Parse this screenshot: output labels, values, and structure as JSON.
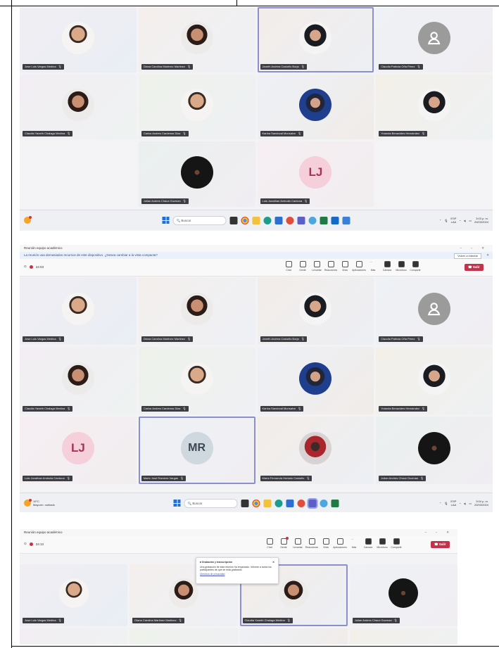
{
  "shot1": {
    "tiles": [
      {
        "name": "Jose Luis Vargas Medina",
        "avatar": "photo"
      },
      {
        "name": "Diana Carolina Martinez Martinez",
        "avatar": "photo"
      },
      {
        "name": "Janeth Andrea Castaño Borja",
        "avatar": "photo"
      },
      {
        "name": "Claudia Patricia Oña Pérez",
        "avatar": "placeholder"
      },
      {
        "name": "Claudia Yaneth Chalaga Medina",
        "avatar": "photo"
      },
      {
        "name": "Carlos Andres Cardenas Diaz",
        "avatar": "photo"
      },
      {
        "name": "Karina Sandoval Monsalve",
        "avatar": "photo"
      },
      {
        "name": "Yolanda Benavides Hernández",
        "avatar": "photo"
      },
      {
        "name": "",
        "avatar": "none"
      },
      {
        "name": "Julian Andres Chaux Guzman",
        "avatar": "photo"
      },
      {
        "name": "Luis Jonathan Ambuila Cardona",
        "avatar": "initials",
        "initials": "LJ"
      }
    ],
    "taskbar": {
      "search": "Buscar",
      "lang": "ESP",
      "region": "LAA",
      "time": "3:03 p. m.",
      "date": "20/03/2024"
    }
  },
  "shot2": {
    "title": "Reunión equipo académico",
    "infobar": "La reunión usa demasiados recursos de este dispositivo. ¿Desea cambiar a la vista compacta?",
    "infobar_button": "Volver a intentar",
    "timer": "24:03",
    "tools": [
      "Chat",
      "Gente",
      "Levantar",
      "Reacciones",
      "Vista",
      "Aplicaciones",
      "Más",
      "Cámara",
      "Micrófono",
      "Compartir"
    ],
    "leave": "Salir",
    "tiles": [
      {
        "name": "Jose Luis Vargas Medina"
      },
      {
        "name": "Diana Carolina Martinez Martinez"
      },
      {
        "name": "Janeth Andrea Castaño Borja"
      },
      {
        "name": "Claudia Patricia Oña Pérez"
      },
      {
        "name": "Claudia Yaneth Chalaga Medina"
      },
      {
        "name": "Carlos Andres Cardenas Diaz"
      },
      {
        "name": "Karina Sandoval Monsalve"
      },
      {
        "name": "Yolanda Benavides Hernández"
      },
      {
        "name": "Luis Jonathan Ambuila Cardona",
        "initials": "LJ"
      },
      {
        "name": "Mario José Ramírez Vargas",
        "initials": "MR"
      },
      {
        "name": "María Fernanda Hurtado Castaño"
      },
      {
        "name": "Julian Andres Chaux Guzman"
      }
    ],
    "taskbar": {
      "weather": "19°C",
      "weather_desc": "Mayorm. nublado",
      "search": "Buscar",
      "lang": "ESP",
      "region": "LAA",
      "time": "3:04 p. m.",
      "date": "20/03/2024"
    }
  },
  "shot3": {
    "title": "Reunión equipo académico",
    "timer": "24:13",
    "tools": [
      "Chat",
      "Gente",
      "Levantar",
      "Reacciones",
      "Vista",
      "Aplicaciones",
      "Más",
      "Cámara",
      "Micrófono",
      "Compartir"
    ],
    "leave": "Salir",
    "popup": {
      "title": "Grabación y transcripción",
      "body": "Una grabación de esta reunión ha empezado. Informe a todos los participantes de que se está grabando.",
      "link": "Directiva de privacidad"
    },
    "tiles": [
      {
        "name": "Jose Luis Vargas Medina"
      },
      {
        "name": "Diana Carolina Martinez Martinez"
      },
      {
        "name": "Claudia Yaneth Chalaga Medina"
      },
      {
        "name": "Julian Andres Chaux Guzman"
      }
    ]
  }
}
